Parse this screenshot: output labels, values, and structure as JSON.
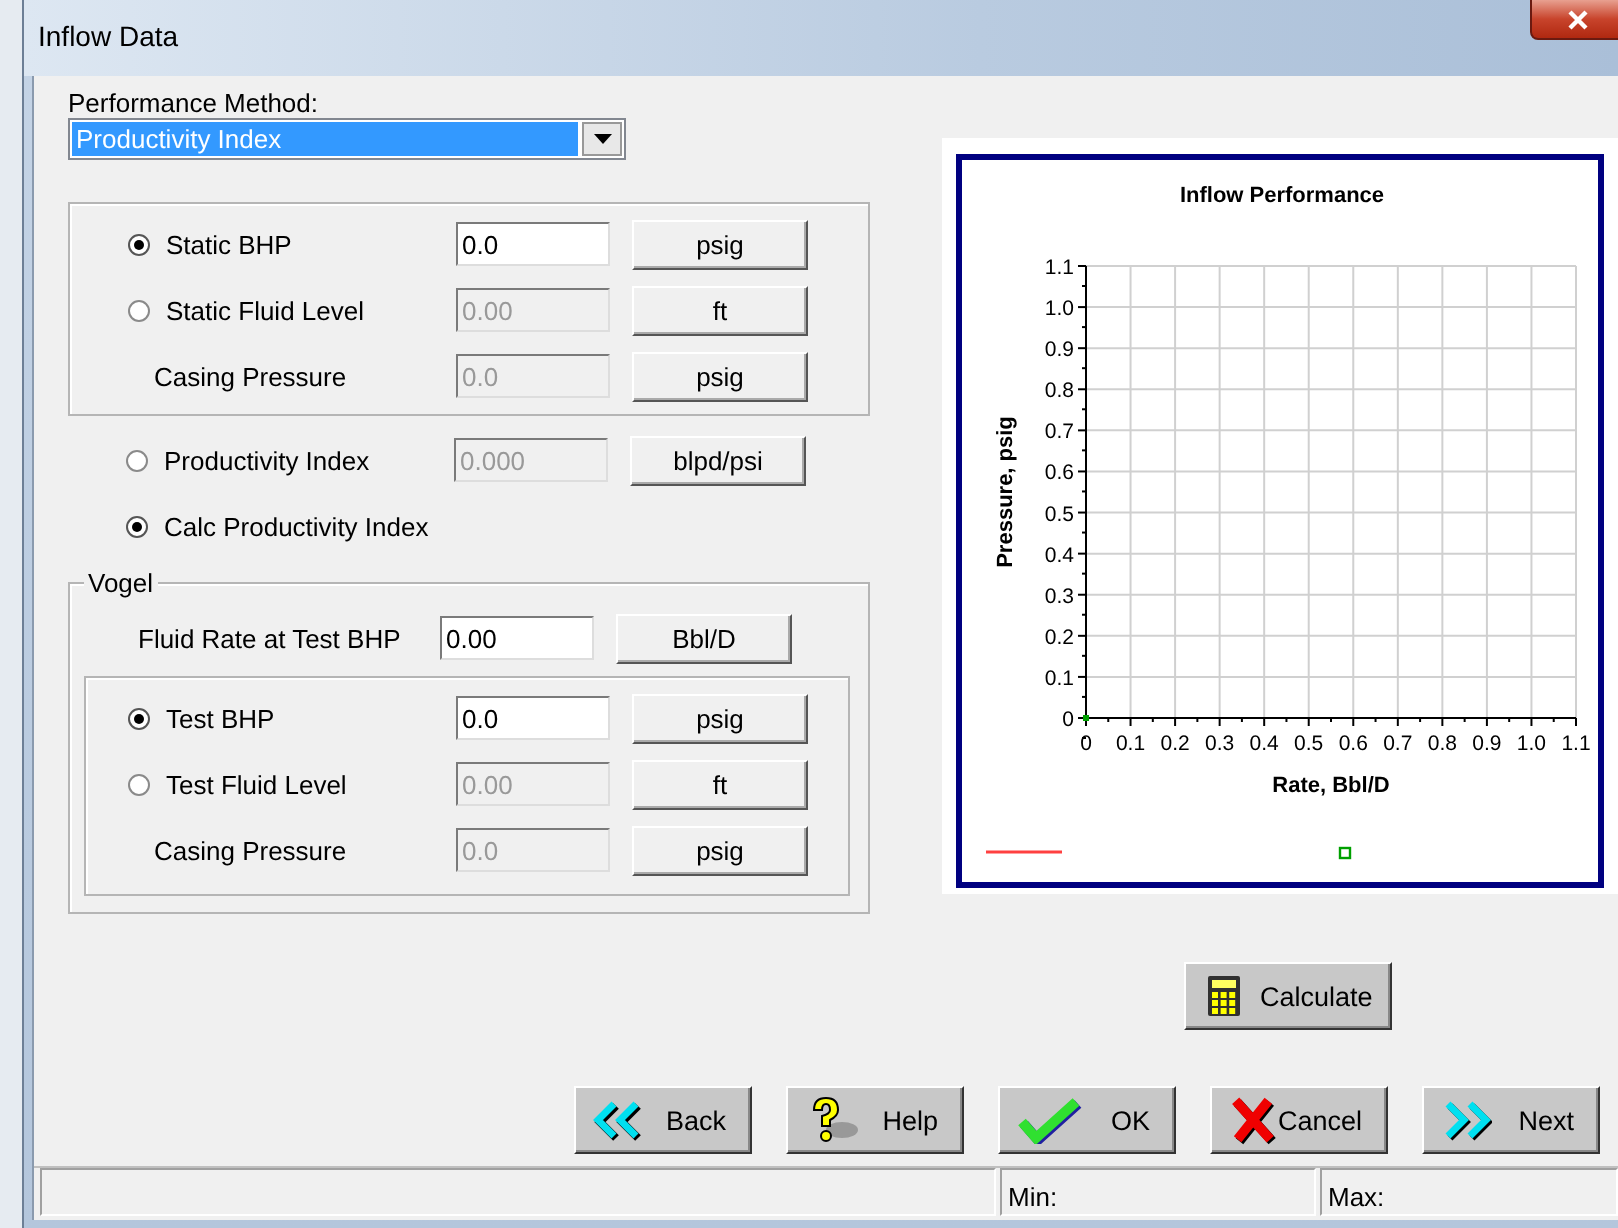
{
  "window": {
    "title": "Inflow Data"
  },
  "performance_method": {
    "label": "Performance Method:",
    "value": "Productivity Index"
  },
  "static_group": {
    "rows": [
      {
        "kind": "radio",
        "label": "Static BHP",
        "selected": true,
        "value": "0.0",
        "disabled": false,
        "unit": "psig"
      },
      {
        "kind": "radio",
        "label": "Static Fluid Level",
        "selected": false,
        "value": "0.00",
        "disabled": true,
        "unit": "ft"
      },
      {
        "kind": "field",
        "label": "Casing Pressure",
        "value": "0.0",
        "disabled": true,
        "unit": "psig"
      }
    ]
  },
  "index_rows": [
    {
      "kind": "radio",
      "label": "Productivity Index",
      "selected": false,
      "value": "0.000",
      "disabled": true,
      "unit": "blpd/psi"
    },
    {
      "kind": "radio_only",
      "label": "Calc Productivity Index",
      "selected": true
    }
  ],
  "vogel": {
    "title": "Vogel",
    "fluid_rate": {
      "kind": "field",
      "label": "Fluid Rate at Test BHP",
      "value": "0.00",
      "disabled": false,
      "unit": "Bbl/D"
    },
    "rows": [
      {
        "kind": "radio",
        "label": "Test BHP",
        "selected": true,
        "value": "0.0",
        "disabled": false,
        "unit": "psig"
      },
      {
        "kind": "radio",
        "label": "Test Fluid Level",
        "selected": false,
        "value": "0.00",
        "disabled": true,
        "unit": "ft"
      },
      {
        "kind": "field",
        "label": "Casing Pressure",
        "value": "0.0",
        "disabled": true,
        "unit": "psig"
      }
    ]
  },
  "chart": {
    "chart_data": {
      "type": "line",
      "title": "Inflow Performance",
      "xlabel": "Rate, Bbl/D",
      "ylabel": "Pressure, psig",
      "x": [
        0
      ],
      "xlim": [
        0,
        1.1
      ],
      "ylim": [
        0,
        1.1
      ],
      "xticks": [
        {
          "value": 0,
          "label": "0"
        },
        0.1,
        0.2,
        0.3,
        0.4,
        0.5,
        0.6,
        0.7,
        0.8,
        0.9,
        {
          "value": 1,
          "label": "1.0"
        },
        1.1
      ],
      "yticks": [
        {
          "value": 0,
          "label": "0"
        },
        0.1,
        0.2,
        0.3,
        0.4,
        0.5,
        0.6,
        0.7,
        0.8,
        0.9,
        {
          "value": 1,
          "label": "1.0"
        },
        1.1
      ],
      "grid": true,
      "series": [
        {
          "color": "#ff4040",
          "marker": false,
          "values": [
            null
          ]
        },
        {
          "color": "#00a000",
          "marker": true,
          "values": [
            0
          ]
        }
      ]
    }
  },
  "calculate": {
    "label": "Calculate"
  },
  "buttons": [
    {
      "kind": "back",
      "label": "Back"
    },
    {
      "kind": "help",
      "label": "Help"
    },
    {
      "kind": "ok",
      "label": "OK"
    },
    {
      "kind": "cancel",
      "label": "Cancel"
    },
    {
      "kind": "next",
      "label": "Next"
    }
  ],
  "status_bar": {
    "cells": [
      "",
      "Min:",
      "Max:"
    ]
  }
}
